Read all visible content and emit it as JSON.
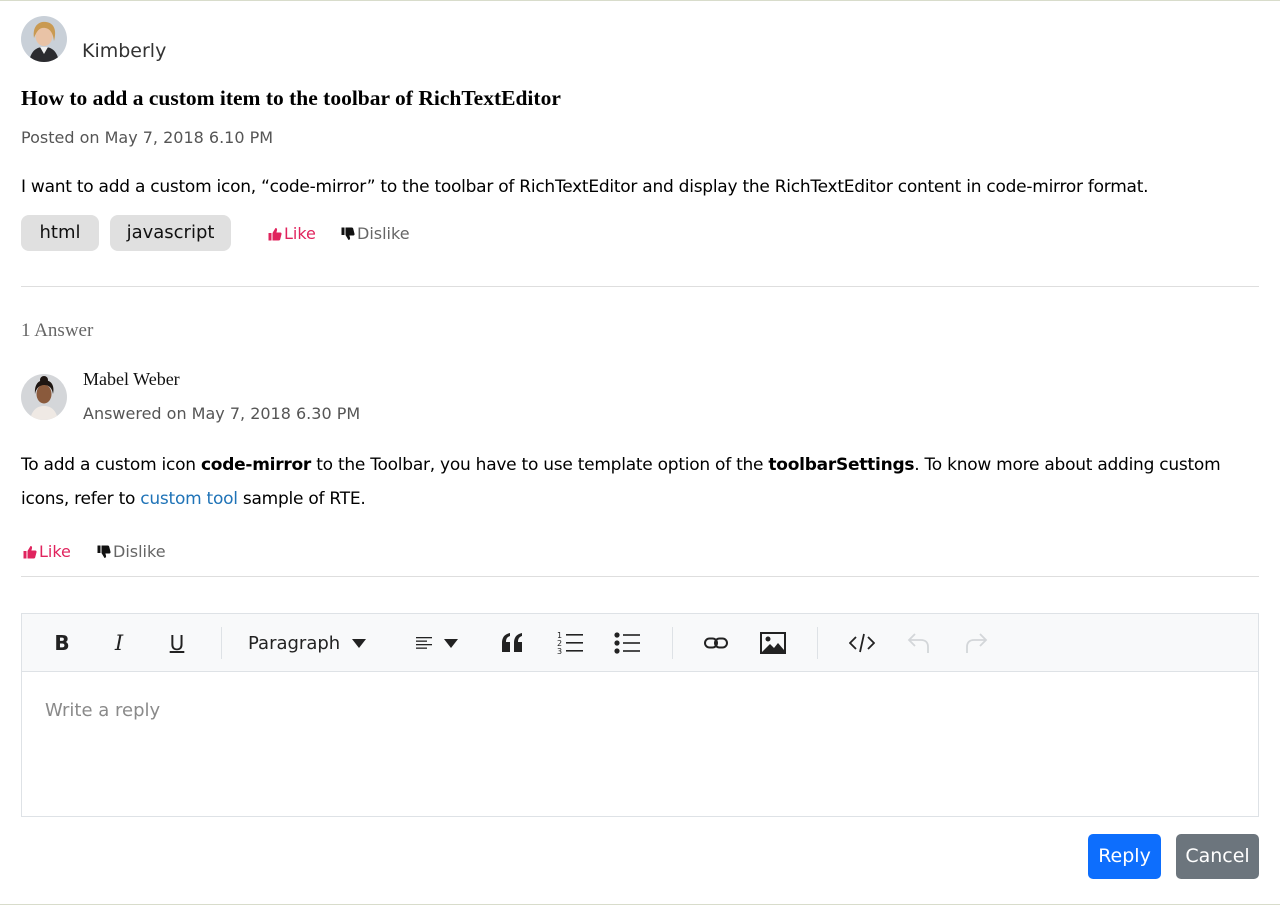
{
  "question": {
    "author": "Kimberly",
    "title": "How to add a custom item to the toolbar of RichTextEditor",
    "posted": "Posted on May 7, 2018 6.10 PM",
    "body": "I want to add a custom icon, “code-mirror” to the toolbar of RichTextEditor and display the RichTextEditor content in code-mirror format.",
    "tags": [
      "html",
      "javascript"
    ],
    "like_label": "Like",
    "dislike_label": "Dislike"
  },
  "answers_count": "1 Answer",
  "answer": {
    "author": "Mabel Weber",
    "answered": "Answered on May 7, 2018 6.30 PM",
    "body_part1": "To add a custom icon ",
    "body_bold1": "code-mirror",
    "body_part2": " to the Toolbar, you have to use template option of the ",
    "body_bold2": "toolbarSettings",
    "body_part3": ". To know more about adding custom icons, refer to ",
    "body_link": "custom tool",
    "body_part4": " sample of RTE.",
    "like_label": "Like",
    "dislike_label": "Dislike"
  },
  "editor": {
    "toolbar": {
      "bold": "B",
      "italic": "I",
      "underline": "U",
      "format": "Paragraph"
    },
    "placeholder": "Write a reply"
  },
  "actions": {
    "reply": "Reply",
    "cancel": "Cancel"
  },
  "colors": {
    "like": "#e0245e",
    "primary": "#0d6efd",
    "secondary": "#6c757d",
    "link": "#1f73b7"
  },
  "icons": [
    "thumbs-up-icon",
    "thumbs-down-icon",
    "chevron-down-icon",
    "align-icon",
    "quote-icon",
    "ordered-list-icon",
    "unordered-list-icon",
    "link-icon",
    "image-icon",
    "code-icon",
    "undo-icon",
    "redo-icon"
  ]
}
